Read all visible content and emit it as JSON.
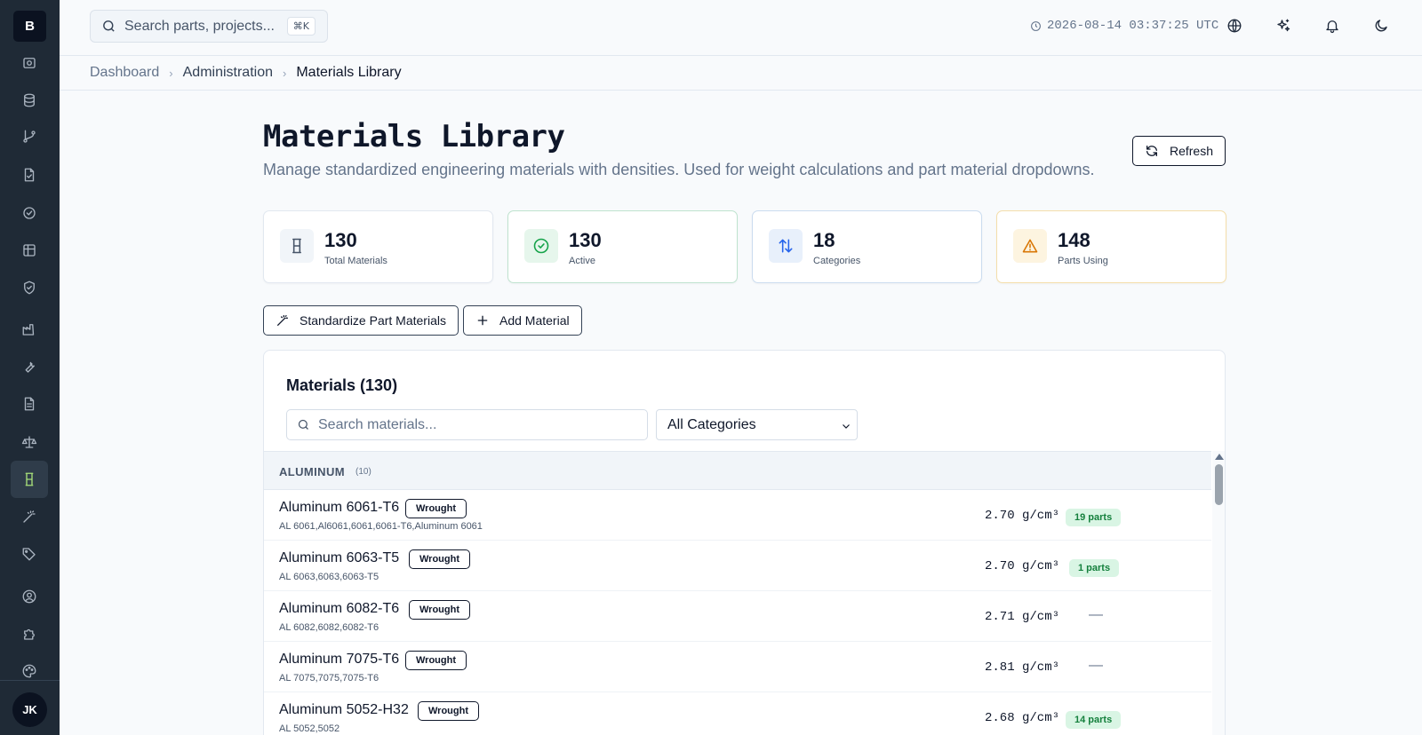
{
  "app": {
    "logo_letter": "B",
    "user_initials": "JK"
  },
  "search": {
    "placeholder": "Search parts, projects...",
    "shortcut": "⌘K"
  },
  "header": {
    "clock": "2026-08-14 03:37:25 UTC"
  },
  "breadcrumb": [
    "Dashboard",
    "Administration",
    "Materials Library"
  ],
  "page": {
    "title": "Materials Library",
    "subtitle": "Manage standardized engineering materials with densities. Used for weight calculations and part material dropdowns.",
    "refresh_label": "Refresh"
  },
  "stats": [
    {
      "value": "130",
      "label": "Total Materials",
      "icon": "material-icon"
    },
    {
      "value": "130",
      "label": "Active",
      "icon": "check-circle-icon"
    },
    {
      "value": "18",
      "label": "Categories",
      "icon": "arrows-up-down-icon"
    },
    {
      "value": "148",
      "label": "Parts Using",
      "icon": "warning-icon"
    }
  ],
  "actions": {
    "standardize": "Standardize Part Materials",
    "add": "Add Material"
  },
  "materials": {
    "title": "Materials (130)",
    "search_placeholder": "Search materials...",
    "category_selected": "All Categories",
    "group": {
      "name": "ALUMINUM",
      "count": "(10)"
    },
    "rows": [
      {
        "name": "Aluminum 6061-T6",
        "form": "Wrought",
        "aliases": "AL 6061,Al6061,6061,6061-T6,Aluminum 6061",
        "density": "2.70 g/cm³",
        "parts": "19 parts"
      },
      {
        "name": "Aluminum 6063-T5",
        "form": "Wrought",
        "aliases": "AL 6063,6063,6063-T5",
        "density": "2.70 g/cm³",
        "parts": "1 parts"
      },
      {
        "name": "Aluminum 6082-T6",
        "form": "Wrought",
        "aliases": "AL 6082,6082,6082-T6",
        "density": "2.71 g/cm³",
        "parts": "—"
      },
      {
        "name": "Aluminum 7075-T6",
        "form": "Wrought",
        "aliases": "AL 7075,7075,7075-T6",
        "density": "2.81 g/cm³",
        "parts": "—"
      },
      {
        "name": "Aluminum 5052-H32",
        "form": "Wrought",
        "aliases": "AL 5052,5052",
        "density": "2.68 g/cm³",
        "parts": "14 parts"
      }
    ]
  },
  "sidebar_icons": [
    "dashboard-icon",
    "database-icon",
    "git-branch-icon",
    "file-icon",
    "check-circle-icon",
    "table-icon",
    "shield-icon",
    "factory-icon",
    "wrench-icon",
    "document-icon",
    "scale-icon",
    "material-icon",
    "wand-icon",
    "tag-icon",
    "user-circle-icon",
    "puzzle-icon",
    "palette-icon"
  ],
  "colors": {
    "sidebar": "#1f2a36",
    "active_icon": "#a8e07a",
    "parts_badge_bg": "#d9f5e4",
    "parts_badge_text": "#15803d"
  }
}
